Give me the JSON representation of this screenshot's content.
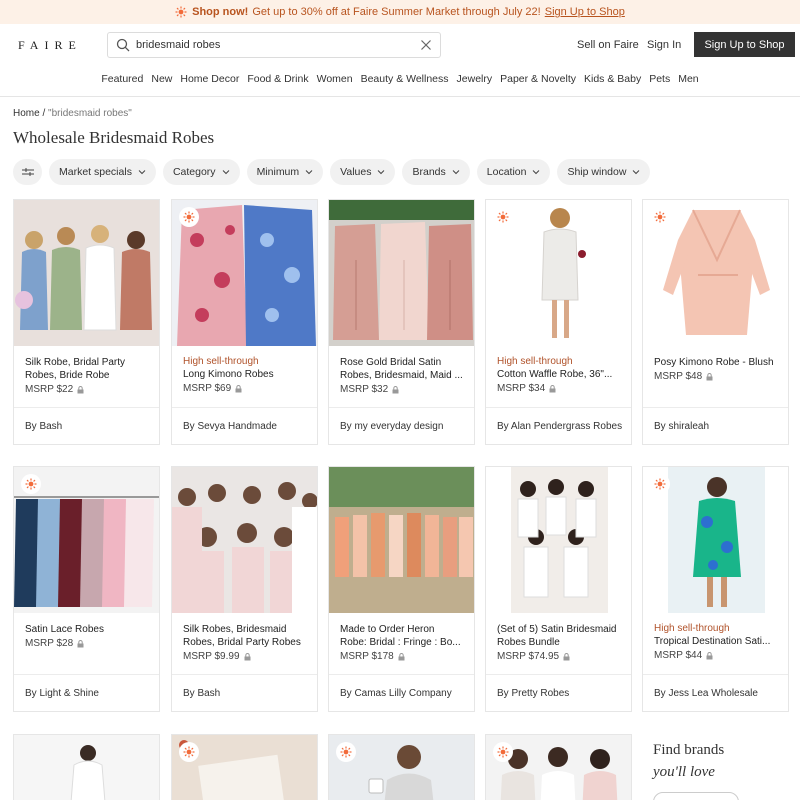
{
  "banner": {
    "strong": "Shop now!",
    "text": "Get up to 30% off at Faire Summer Market through July 22!",
    "link": "Sign Up to Shop",
    "color": "#b8541f"
  },
  "header": {
    "logo": "FAIRE",
    "search_value": "bridesmaid robes",
    "sell_link": "Sell on Faire",
    "signin_link": "Sign In",
    "signup_button": "Sign Up to Shop"
  },
  "nav": [
    "Featured",
    "New",
    "Home Decor",
    "Food & Drink",
    "Women",
    "Beauty & Wellness",
    "Jewelry",
    "Paper & Novelty",
    "Kids & Baby",
    "Pets",
    "Men"
  ],
  "breadcrumb": {
    "home": "Home",
    "sep": "/",
    "current": "\"bridesmaid robes\""
  },
  "page_title": "Wholesale Bridesmaid Robes",
  "filters": [
    "Market specials",
    "Category",
    "Minimum",
    "Values",
    "Brands",
    "Location",
    "Ship window"
  ],
  "products": [
    {
      "tag": "",
      "name": "Silk Robe, Bridal Party Robes, Bride Robe",
      "msrp": "MSRP $22",
      "brand": "By Bash",
      "badge": false,
      "icon": "robes-photo"
    },
    {
      "tag": "High sell-through",
      "name": "Long Kimono Robes",
      "msrp": "MSRP $69",
      "brand": "By Sevya Handmade",
      "badge": true,
      "icon": "kimono-photo"
    },
    {
      "tag": "",
      "name": "Rose Gold Bridal Satin Robes, Bridesmaid, Maid ...",
      "msrp": "MSRP $32",
      "brand": "By my everyday design",
      "badge": false,
      "icon": "satin-robes-photo"
    },
    {
      "tag": "High sell-through",
      "name": "Cotton Waffle Robe, 36\"...",
      "msrp": "MSRP $34",
      "brand": "By Alan Pendergrass Robes",
      "badge": true,
      "icon": "waffle-robe-photo"
    },
    {
      "tag": "",
      "name": "Posy Kimono Robe - Blush",
      "msrp": "MSRP $48",
      "brand": "By shiraleah",
      "badge": true,
      "icon": "posy-robe-photo"
    },
    {
      "tag": "",
      "name": "Satin Lace Robes",
      "msrp": "MSRP $28",
      "brand": "By Light & Shine",
      "badge": true,
      "icon": "lace-robes-photo"
    },
    {
      "tag": "",
      "name": "Silk Robes, Bridesmaid Robes, Bridal Party Robes",
      "msrp": "MSRP $9.99",
      "brand": "By Bash",
      "badge": false,
      "icon": "bridal-party-photo"
    },
    {
      "tag": "",
      "name": "Made to Order Heron Robe: Bridal : Fringe : Bo...",
      "msrp": "MSRP $178",
      "brand": "By Camas Lilly Company",
      "badge": false,
      "icon": "heron-robe-photo"
    },
    {
      "tag": "",
      "name": "(Set of 5) Satin Bridesmaid Robes Bundle",
      "msrp": "MSRP $74.95",
      "brand": "By Pretty Robes",
      "badge": false,
      "icon": "satin-bundle-photo"
    },
    {
      "tag": "High sell-through",
      "name": "Tropical Destination Sati...",
      "msrp": "MSRP $44",
      "brand": "By Jess Lea Wholesale",
      "badge": true,
      "icon": "tropical-robe-photo"
    }
  ],
  "promo": {
    "title": "Find brands",
    "subtitle": "you'll love"
  },
  "colors": {
    "accent": "#f26b3a",
    "tag": "#b0522a",
    "dark_button": "#333333"
  }
}
